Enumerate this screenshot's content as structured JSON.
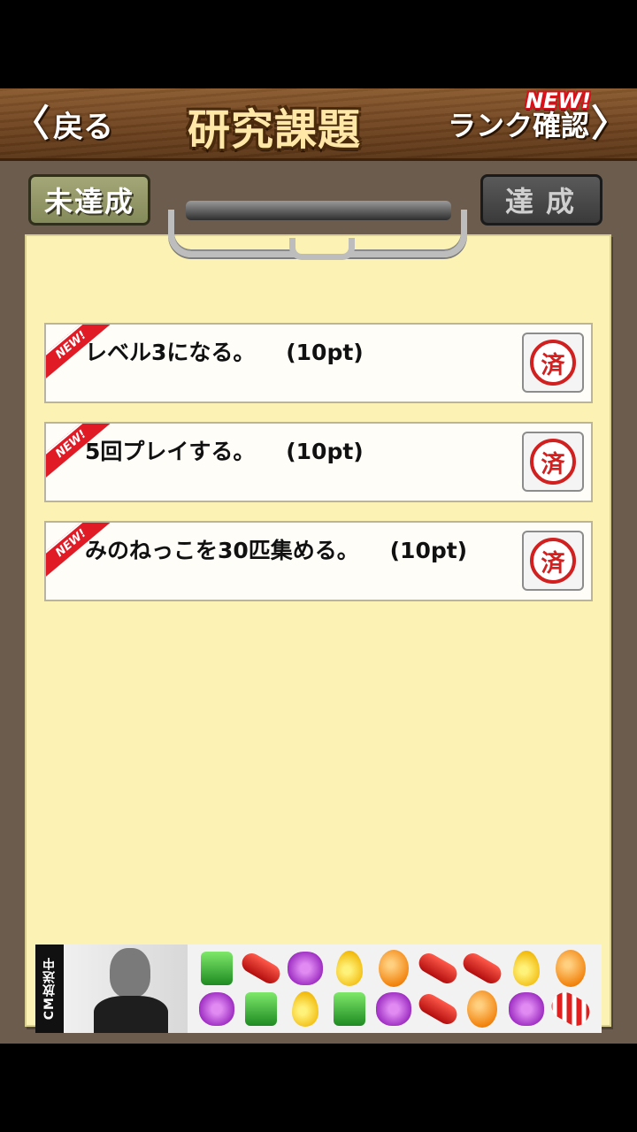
{
  "header": {
    "back_label": "戻る",
    "back_chevron": "〈",
    "title": "研究課題",
    "rank_label": "ランク確認",
    "rank_chevron": "〉",
    "new_badge": "NEW!"
  },
  "tabs": {
    "unachieved": "未達成",
    "achieved": "達成"
  },
  "tasks": [
    {
      "new": "NEW!",
      "text": "レベル3になる。",
      "points": "(10pt)",
      "done_label": "済"
    },
    {
      "new": "NEW!",
      "text": "5回プレイする。",
      "points": "(10pt)",
      "done_label": "済"
    },
    {
      "new": "NEW!",
      "text": "みのねっこを30匹集める。",
      "points": "(10pt)",
      "done_label": "済"
    }
  ],
  "ad": {
    "side_text": "CM放送中",
    "candies": [
      "green",
      "red",
      "purple",
      "yellow",
      "orange",
      "red",
      "red",
      "yellow",
      "orange",
      "purple",
      "green",
      "yellow",
      "green",
      "purple",
      "red",
      "orange",
      "purple",
      "striped"
    ]
  },
  "colors": {
    "paper": "#fbf2b3",
    "background": "#6b5c4d",
    "accent_red": "#e11b25",
    "header_wood": "#6f4420"
  }
}
